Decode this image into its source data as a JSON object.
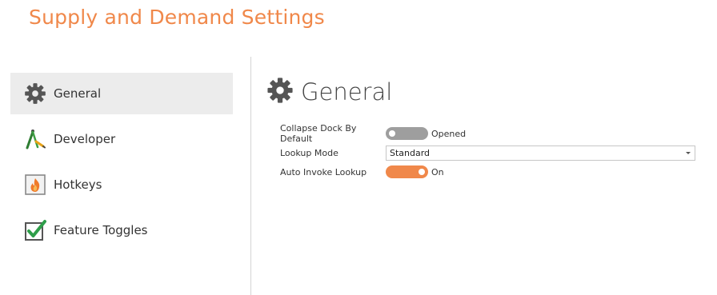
{
  "window": {
    "title": "Supply and Demand Settings"
  },
  "sidebar": {
    "items": [
      {
        "label": "General",
        "icon": "gear-icon",
        "selected": true
      },
      {
        "label": "Developer",
        "icon": "compass-pencil-icon",
        "selected": false
      },
      {
        "label": "Hotkeys",
        "icon": "flame-icon",
        "selected": false
      },
      {
        "label": "Feature Toggles",
        "icon": "checkbox-checked-icon",
        "selected": false
      }
    ]
  },
  "main": {
    "heading": "General",
    "heading_icon": "gear-icon",
    "settings": {
      "collapse_dock": {
        "label": "Collapse Dock By Default",
        "state": "off",
        "state_text": "Opened"
      },
      "lookup_mode": {
        "label": "Lookup Mode",
        "value": "Standard"
      },
      "auto_invoke": {
        "label": "Auto Invoke Lookup",
        "state": "on",
        "state_text": "On"
      }
    }
  },
  "colors": {
    "accent": "#F0884A",
    "selected_bg": "#ECECEC",
    "toggle_off": "#9E9E9E",
    "icon_gray": "#555555",
    "check_green": "#2E9E4A"
  }
}
